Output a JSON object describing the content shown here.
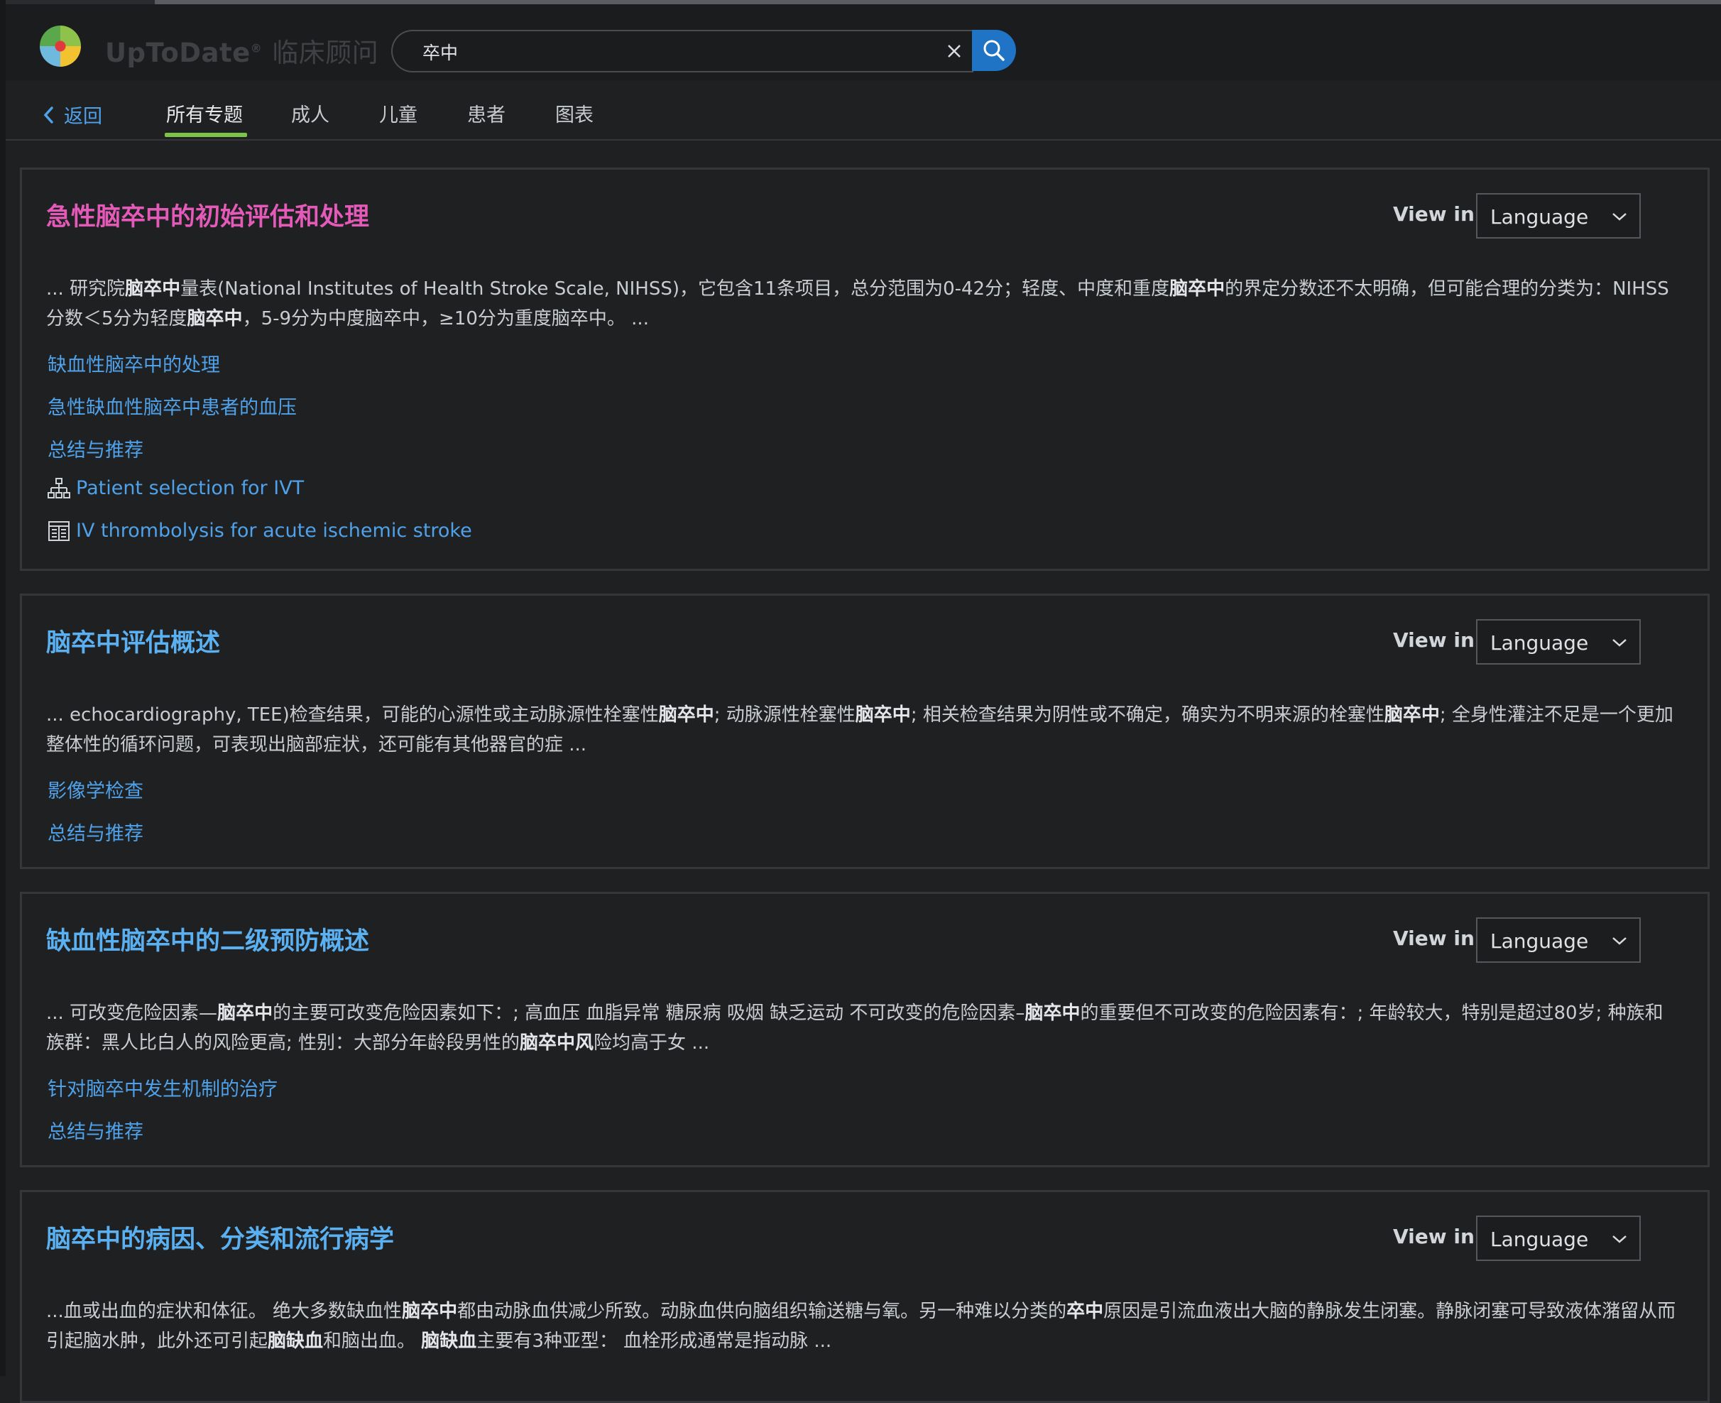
{
  "header": {
    "brand": "UpToDate",
    "brand_reg": "®",
    "brand_cn": "临床顾问",
    "search_value": "卒中"
  },
  "nav": {
    "back": "返回",
    "tabs": [
      "所有专题",
      "成人",
      "儿童",
      "患者",
      "图表"
    ],
    "active_tab": "所有专题"
  },
  "view_in_label": "View in",
  "language_label": "Language",
  "results": [
    {
      "title": "急性脑卒中的初始评估和处理",
      "visited": true,
      "snippet": [
        "... 研究院",
        {
          "b": "脑卒中"
        },
        "量表(National Institutes of Health Stroke Scale, NIHSS)，它包含11条项目，总分范围为0-42分；轻度、中度和重度",
        {
          "b": "脑卒中"
        },
        "的界定分数还不太明确，但可能合理的分类为：NIHSS分数＜5分为轻度",
        {
          "b": "脑卒中"
        },
        "，5-9分为中度脑卒中，≥10分为重度脑卒中。 ..."
      ],
      "links": [
        {
          "text": "缺血性脑卒中的处理",
          "icon": ""
        },
        {
          "text": "急性缺血性脑卒中患者的血压",
          "icon": ""
        },
        {
          "text": "总结与推荐",
          "icon": ""
        },
        {
          "text": "Patient selection for IVT",
          "icon": "algorithm-icon"
        },
        {
          "text": "IV thrombolysis for acute ischemic stroke",
          "icon": "table-icon"
        }
      ]
    },
    {
      "title": "脑卒中评估概述",
      "visited": false,
      "snippet": [
        "... echocardiography, TEE)检查结果，可能的心源性或主动脉源性栓塞性",
        {
          "b": "脑卒中"
        },
        "; 动脉源性栓塞性",
        {
          "b": "脑卒中"
        },
        "; 相关检查结果为阴性或不确定，确实为不明来源的栓塞性",
        {
          "b": "脑卒中"
        },
        "; 全身性灌注不足是一个更加整体性的循环问题，可表现出脑部症状，还可能有其他器官的症 ..."
      ],
      "links": [
        {
          "text": "影像学检查",
          "icon": ""
        },
        {
          "text": "总结与推荐",
          "icon": ""
        }
      ]
    },
    {
      "title": "缺血性脑卒中的二级预防概述",
      "visited": false,
      "snippet": [
        "... 可改变危险因素—",
        {
          "b": "脑卒中"
        },
        "的主要可改变危险因素如下：; 高血压 血脂异常 糖尿病 吸烟 缺乏运动 不可改变的危险因素–",
        {
          "b": "脑卒中"
        },
        "的重要但不可改变的危险因素有：; 年龄较大，特别是超过80岁; 种族和族群：黑人比白人的风险更高; 性别：大部分年龄段男性的",
        {
          "b": "脑卒中风"
        },
        "险均高于女 ..."
      ],
      "links": [
        {
          "text": "针对脑卒中发生机制的治疗",
          "icon": ""
        },
        {
          "text": "总结与推荐",
          "icon": ""
        }
      ]
    },
    {
      "title": "脑卒中的病因、分类和流行病学",
      "visited": false,
      "snippet": [
        "...血或出血的症状和体征。 绝大多数缺血性",
        {
          "b": "脑卒中"
        },
        "都由动脉血供减少所致。动脉血供向脑组织输送糖与氧。另一种难以分类的",
        {
          "b": "卒中"
        },
        "原因是引流血液出大脑的静脉发生闭塞。静脉闭塞可导致液体潴留从而引起脑水肿，此外还可引起",
        {
          "b": "脑缺血"
        },
        "和脑出血。 ",
        {
          "b": "脑缺血"
        },
        "主要有3种亚型： 血栓形成通常是指动脉 ..."
      ],
      "links": []
    }
  ]
}
